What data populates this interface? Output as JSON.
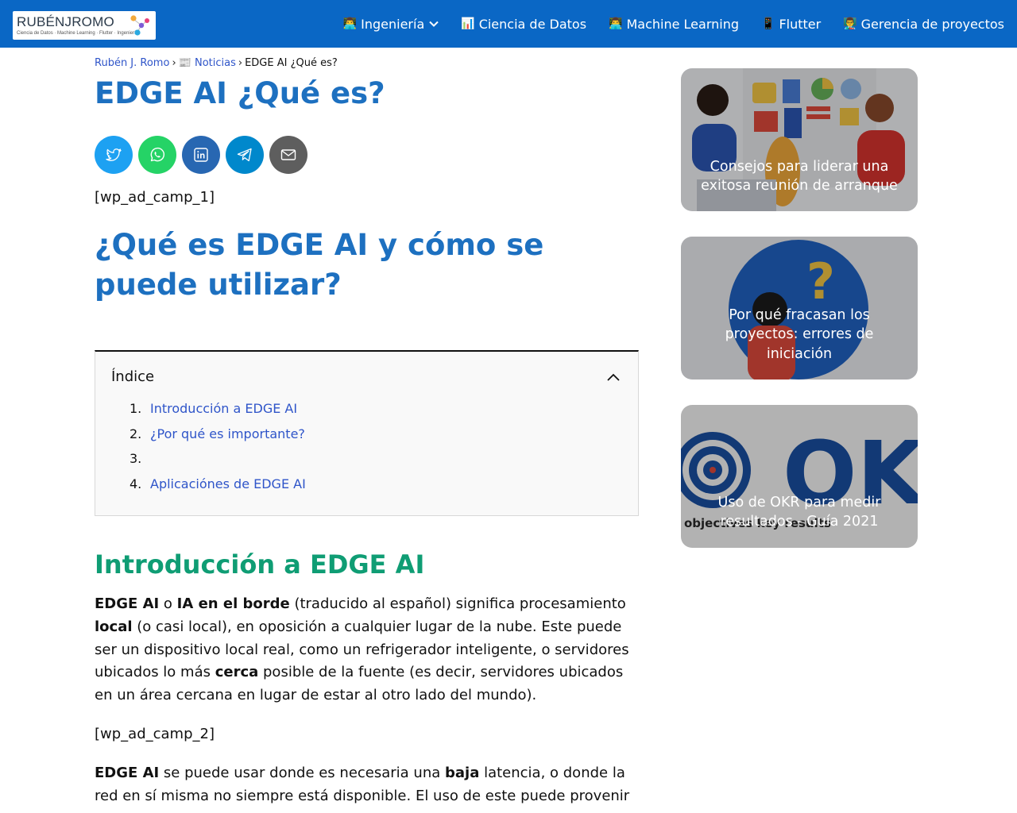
{
  "header": {
    "logo_name": "RUBÉNJROMO",
    "logo_tagline": "Ciencia de Datos · Machine Learning · Flutter · Ingeniería",
    "nav": [
      {
        "emoji": "👨‍💻",
        "label": "Ingeniería",
        "has_dropdown": true
      },
      {
        "emoji": "📊",
        "label": "Ciencia de Datos"
      },
      {
        "emoji": "👨‍💻",
        "label": "Machine Learning"
      },
      {
        "emoji": "📱",
        "label": "Flutter"
      },
      {
        "emoji": "👨‍🏫",
        "label": "Gerencia de proyectos"
      }
    ],
    "bar_color": "#0a67c5"
  },
  "breadcrumb": {
    "home": "Rubén J. Romo",
    "separator": "›",
    "category_emoji": "📰",
    "category": "Noticias",
    "current": "EDGE AI ¿Qué es?"
  },
  "article": {
    "title": "EDGE AI ¿Qué es?",
    "share_buttons": [
      {
        "network": "twitter",
        "color": "#1da1f2"
      },
      {
        "network": "whatsapp",
        "color": "#25d366"
      },
      {
        "network": "linkedin",
        "color": "#2867b2"
      },
      {
        "network": "telegram",
        "color": "#0088cc"
      },
      {
        "network": "email",
        "color": "#5e5e5e"
      }
    ],
    "ad1": "[wp_ad_camp_1]",
    "heading": "¿Qué es EDGE AI y cómo se puede utilizar?",
    "toc": {
      "title": "Índice",
      "items": [
        {
          "num": "1.",
          "label": "Introducción a EDGE AI"
        },
        {
          "num": "2.",
          "label": "¿Por qué es importante?"
        },
        {
          "num": "3.",
          "label": ""
        },
        {
          "num": "4.",
          "label": "Aplicaciónes de EDGE AI"
        }
      ]
    },
    "section_heading": "Introducción a EDGE AI",
    "p1": {
      "b1": "EDGE AI",
      "t1": " o ",
      "b2": "IA en el borde",
      "t2": " (traducido al español) significa procesamiento ",
      "b3": "local",
      "t3": " (o casi local), en oposición a cualquier lugar de la nube. Este puede ser un dispositivo local real, como un refrigerador inteligente, o servidores ubicados lo más ",
      "b4": "cerca",
      "t4": " posible de la fuente (es decir, servidores ubicados en un área cercana en lugar de estar al otro lado del mundo)."
    },
    "ad2": "[wp_ad_camp_2]",
    "p2": {
      "b1": "EDGE AI",
      "t1": " se puede usar donde es necesaria una ",
      "b2": "baja",
      "t2": " latencia, o donde la red en sí misma no siempre está disponible. El uso de este puede provenir"
    }
  },
  "sidebar": {
    "cards": [
      {
        "title": "Consejos para liderar una exitosa reunión de arranque"
      },
      {
        "title": "Por qué fracasan los proyectos: errores de iniciación"
      },
      {
        "title": "Uso de OKR para medir resultados - Guía 2021",
        "image_text": "OKR",
        "image_subtext": "objectives key results"
      }
    ]
  },
  "colors": {
    "title_blue": "#1d70c0",
    "section_green": "#0f9d74",
    "link_blue": "#2f55c9"
  }
}
